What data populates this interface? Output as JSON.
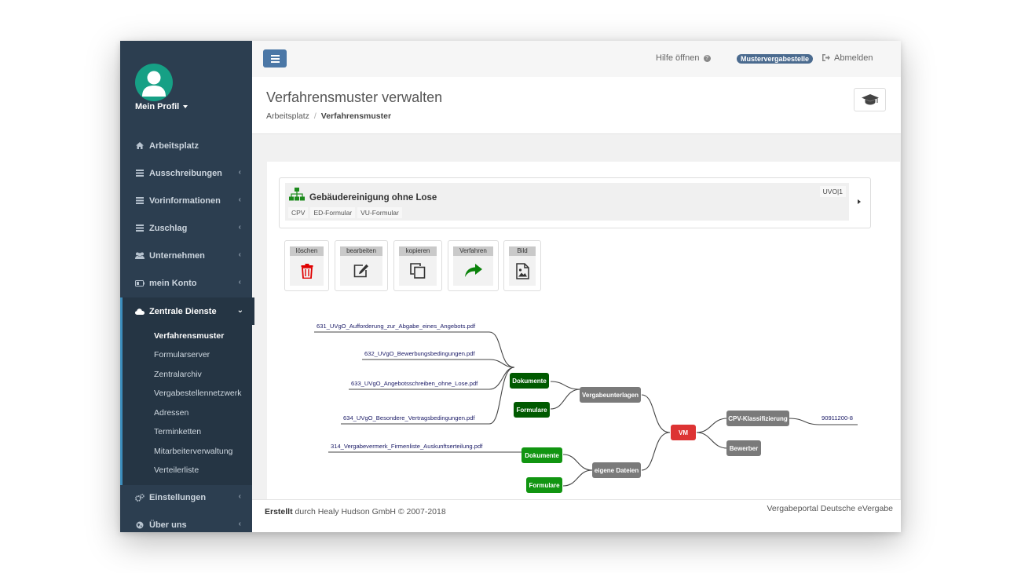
{
  "sidebar": {
    "profile_label": "Mein Profil",
    "items": [
      {
        "label": "Arbeitsplatz",
        "icon": "home-icon"
      },
      {
        "label": "Ausschreibungen",
        "icon": "list-icon"
      },
      {
        "label": "Vorinformationen",
        "icon": "list-icon"
      },
      {
        "label": "Zuschlag",
        "icon": "list-icon"
      },
      {
        "label": "Unternehmen",
        "icon": "users-icon"
      },
      {
        "label": "mein Konto",
        "icon": "battery-icon"
      },
      {
        "label": "Zentrale Dienste",
        "icon": "cloud-icon"
      },
      {
        "label": "Einstellungen",
        "icon": "cogs-icon"
      },
      {
        "label": "Über uns",
        "icon": "globe-icon"
      }
    ],
    "subitems": [
      "Verfahrensmuster",
      "Formularserver",
      "Zentralarchiv",
      "Vergabestellennetzwerk",
      "Adressen",
      "Terminketten",
      "Mitarbeiterverwaltung",
      "Verteilerliste"
    ]
  },
  "topbar": {
    "help_label": "Hilfe öffnen",
    "org_badge": "Mustervergabestelle",
    "logout_label": "Abmelden"
  },
  "header": {
    "title": "Verfahrensmuster verwalten",
    "breadcrumb_root": "Arbeitsplatz",
    "breadcrumb_sep": "/",
    "breadcrumb_current": "Verfahrensmuster"
  },
  "card": {
    "title": "Gebäudereinigung ohne Lose",
    "tags": [
      "CPV",
      "ED-Formular",
      "VU-Formular"
    ],
    "badge": "UVO|1"
  },
  "actions": [
    {
      "label": "löschen",
      "icon": "trash-icon"
    },
    {
      "label": "bearbeiten",
      "icon": "edit-icon"
    },
    {
      "label": "kopieren",
      "icon": "copy-icon"
    },
    {
      "label": "Verfahren",
      "icon": "share-arrow-icon"
    },
    {
      "label": "Bild",
      "icon": "image-file-icon"
    }
  ],
  "mindmap": {
    "root": "VM",
    "nodes": {
      "vergabeunterlagen": "Vergabeunterlagen",
      "dokumente_1": "Dokumente",
      "formulare_1": "Formulare",
      "eigene_dateien": "eigene Dateien",
      "dokumente_2": "Dokumente",
      "formulare_2": "Formulare",
      "cpv": "CPV-Klassifizierung",
      "bewerber": "Bewerber"
    },
    "leaves": {
      "l1": "631_UVgO_Aufforderung_zur_Abgabe_eines_Angebots.pdf",
      "l2": "632_UVgO_Bewerbungsbedingungen.pdf",
      "l3": "633_UVgO_Angebotsschreiben_ohne_Lose.pdf",
      "l4": "634_UVgO_Besondere_Vertragsbedingungen.pdf",
      "l5": "314_Vergabevermerk_Firmenliste_Auskunftserteilung.pdf",
      "cpv_code": "90911200-8"
    },
    "colors": {
      "dark_green": "#005a00",
      "green": "#119511",
      "gray": "#7a7a7a",
      "red": "#dd3333"
    }
  },
  "footer": {
    "created_bold": "Erstellt",
    "created_rest": "durch Healy Hudson GmbH © 2007-2018",
    "right": "Vergabeportal Deutsche eVergabe"
  }
}
